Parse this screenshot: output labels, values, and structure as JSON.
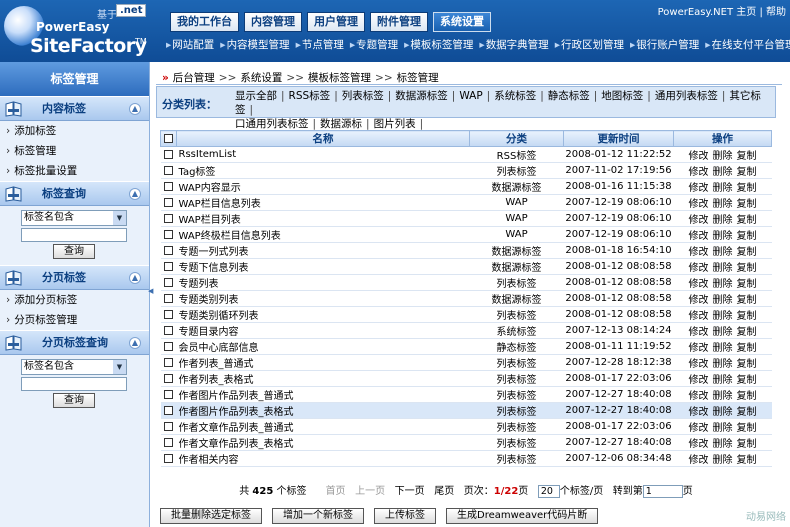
{
  "logo": {
    "based_on": "基于",
    "net_badge": ".net",
    "brand_small": "PowerEasy",
    "brand_big": "SiteFactory",
    "tm": "TM"
  },
  "top_nav": [
    {
      "label": "我的工作台",
      "active": false
    },
    {
      "label": "内容管理",
      "active": false
    },
    {
      "label": "用户管理",
      "active": false
    },
    {
      "label": "附件管理",
      "active": false
    },
    {
      "label": "系统设置",
      "active": true
    }
  ],
  "top_links": {
    "home": "PowerEasy.NET 主页",
    "help": "帮助",
    "divider": "|"
  },
  "sub_nav": [
    "网站配置",
    "内容模型管理",
    "节点管理",
    "专题管理",
    "模板标签管理",
    "数据字典管理",
    "行政区划管理",
    "银行账户管理",
    "在线支付平台管理"
  ],
  "sidebar": {
    "title": "标签管理",
    "sections": [
      {
        "title": "内容标签",
        "items": [
          "添加标签",
          "标签管理",
          "标签批量设置"
        ]
      },
      {
        "title": "标签查询",
        "select": "标签名包含",
        "button": "查询"
      },
      {
        "title": "分页标签",
        "items": [
          "添加分页标签",
          "分页标签管理"
        ]
      },
      {
        "title": "分页标签查询",
        "select": "标签名包含",
        "button": "查询"
      }
    ]
  },
  "breadcrumb": [
    "后台管理",
    "系统设置",
    "模板标签管理",
    "标签管理"
  ],
  "breadcrumb_sep": ">>",
  "category": {
    "label": "分类列表：",
    "row1": [
      "显示全部",
      "RSS标签",
      "列表标签",
      "数据源标签",
      "WAP",
      "系统标签",
      "静态标签",
      "地图标签",
      "通用列表标签",
      "其它标签"
    ],
    "row2": [
      "口通用列表标签",
      "数据源标",
      "图片列表"
    ]
  },
  "table": {
    "headers": {
      "name": "名称",
      "type": "分类",
      "time": "更新时间",
      "ops": "操作"
    },
    "ops": [
      "修改",
      "删除",
      "复制"
    ],
    "rows": [
      {
        "name": "RssItemList",
        "type": "RSS标签",
        "time": "2008-01-12 11:22:52"
      },
      {
        "name": "Tag标签",
        "type": "列表标签",
        "time": "2007-11-02 17:19:56"
      },
      {
        "name": "WAP内容显示",
        "type": "数据源标签",
        "time": "2008-01-16 11:15:38"
      },
      {
        "name": "WAP栏目信息列表",
        "type": "WAP",
        "time": "2007-12-19 08:06:10"
      },
      {
        "name": "WAP栏目列表",
        "type": "WAP",
        "time": "2007-12-19 08:06:10"
      },
      {
        "name": "WAP终极栏目信息列表",
        "type": "WAP",
        "time": "2007-12-19 08:06:10"
      },
      {
        "name": "专题一列式列表",
        "type": "数据源标签",
        "time": "2008-01-18 16:54:10"
      },
      {
        "name": "专题下信息列表",
        "type": "数据源标签",
        "time": "2008-01-12 08:08:58"
      },
      {
        "name": "专题列表",
        "type": "列表标签",
        "time": "2008-01-12 08:08:58"
      },
      {
        "name": "专题类别列表",
        "type": "数据源标签",
        "time": "2008-01-12 08:08:58"
      },
      {
        "name": "专题类别循环列表",
        "type": "列表标签",
        "time": "2008-01-12 08:08:58"
      },
      {
        "name": "专题目录内容",
        "type": "系统标签",
        "time": "2007-12-13 08:14:24"
      },
      {
        "name": "会员中心底部信息",
        "type": "静态标签",
        "time": "2008-01-11 11:19:52"
      },
      {
        "name": "作者列表_普通式",
        "type": "列表标签",
        "time": "2007-12-28 18:12:38"
      },
      {
        "name": "作者列表_表格式",
        "type": "列表标签",
        "time": "2008-01-17 22:03:06"
      },
      {
        "name": "作者图片作品列表_普通式",
        "type": "列表标签",
        "time": "2007-12-27 18:40:08"
      },
      {
        "name": "作者图片作品列表_表格式",
        "type": "列表标签",
        "time": "2007-12-27 18:40:08",
        "highlight": true
      },
      {
        "name": "作者文章作品列表_普通式",
        "type": "列表标签",
        "time": "2008-01-17 22:03:06"
      },
      {
        "name": "作者文章作品列表_表格式",
        "type": "列表标签",
        "time": "2007-12-27 18:40:08"
      },
      {
        "name": "作者相关内容",
        "type": "列表标签",
        "time": "2007-12-06 08:34:48"
      }
    ]
  },
  "pager": {
    "total_pre": "共",
    "total": "425",
    "total_post": "个标签",
    "first": "首页",
    "prev": "上一页",
    "next": "下一页",
    "last": "尾页",
    "page_label": "页次：",
    "page": "1/22",
    "page_unit": "页",
    "per_page": "20",
    "per_page_unit": "个标签/页",
    "goto_pre": "转到第",
    "goto_value": "1",
    "goto_post": "页"
  },
  "actions": [
    "批量删除选定标签",
    "增加一个新标签",
    "上传标签",
    "生成Dreamweaver代码片断"
  ],
  "watermark": "动易网络",
  "colors": {
    "header": "#1d66b4",
    "accent_red": "#cc0000",
    "sidebar_bg": "#e9f1fb",
    "highlight_row": "#d9e7f8"
  }
}
